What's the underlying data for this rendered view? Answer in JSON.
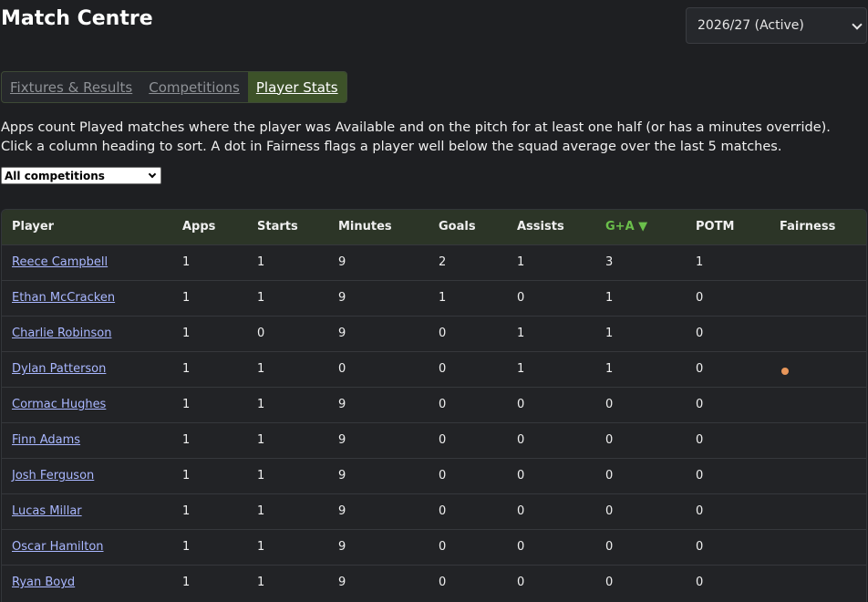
{
  "page": {
    "title": "Match Centre"
  },
  "season_select": {
    "value": "2026/27 (Active)"
  },
  "tabs": [
    {
      "label": "Fixtures & Results",
      "active": false
    },
    {
      "label": "Competitions",
      "active": false
    },
    {
      "label": "Player Stats",
      "active": true
    }
  ],
  "description": "Apps count Played matches where the player was Available and on the pitch for at least one half (or has a minutes override). Click a column heading to sort. A dot in Fairness flags a player well below the squad average over the last 5 matches.",
  "competition_filter": {
    "value": "All competitions"
  },
  "table": {
    "headers": {
      "player": "Player",
      "apps": "Apps",
      "starts": "Starts",
      "minutes": "Minutes",
      "goals": "Goals",
      "assists": "Assists",
      "ga": "G+A",
      "ga_sort_indicator": "▼",
      "potm": "POTM",
      "fairness": "Fairness"
    },
    "sorted_by": "G+A",
    "sort_direction": "descending",
    "sort_color": "#6bc04b",
    "fairness_dot_color": "#e8965a",
    "rows": [
      {
        "player": "Reece Campbell",
        "apps": "1",
        "starts": "1",
        "minutes": "9",
        "goals": "2",
        "assists": "1",
        "ga": "3",
        "potm": "1",
        "fairness_flag": false
      },
      {
        "player": "Ethan McCracken",
        "apps": "1",
        "starts": "1",
        "minutes": "9",
        "goals": "1",
        "assists": "0",
        "ga": "1",
        "potm": "0",
        "fairness_flag": false
      },
      {
        "player": "Charlie Robinson",
        "apps": "1",
        "starts": "0",
        "minutes": "9",
        "goals": "0",
        "assists": "1",
        "ga": "1",
        "potm": "0",
        "fairness_flag": false
      },
      {
        "player": "Dylan Patterson",
        "apps": "1",
        "starts": "1",
        "minutes": "0",
        "goals": "0",
        "assists": "1",
        "ga": "1",
        "potm": "0",
        "fairness_flag": true
      },
      {
        "player": "Cormac Hughes",
        "apps": "1",
        "starts": "1",
        "minutes": "9",
        "goals": "0",
        "assists": "0",
        "ga": "0",
        "potm": "0",
        "fairness_flag": false
      },
      {
        "player": "Finn Adams",
        "apps": "1",
        "starts": "1",
        "minutes": "9",
        "goals": "0",
        "assists": "0",
        "ga": "0",
        "potm": "0",
        "fairness_flag": false
      },
      {
        "player": "Josh Ferguson",
        "apps": "1",
        "starts": "1",
        "minutes": "9",
        "goals": "0",
        "assists": "0",
        "ga": "0",
        "potm": "0",
        "fairness_flag": false
      },
      {
        "player": "Lucas Millar",
        "apps": "1",
        "starts": "1",
        "minutes": "9",
        "goals": "0",
        "assists": "0",
        "ga": "0",
        "potm": "0",
        "fairness_flag": false
      },
      {
        "player": "Oscar Hamilton",
        "apps": "1",
        "starts": "1",
        "minutes": "9",
        "goals": "0",
        "assists": "0",
        "ga": "0",
        "potm": "0",
        "fairness_flag": false
      },
      {
        "player": "Ryan Boyd",
        "apps": "1",
        "starts": "1",
        "minutes": "9",
        "goals": "0",
        "assists": "0",
        "ga": "0",
        "potm": "0",
        "fairness_flag": false
      }
    ]
  }
}
